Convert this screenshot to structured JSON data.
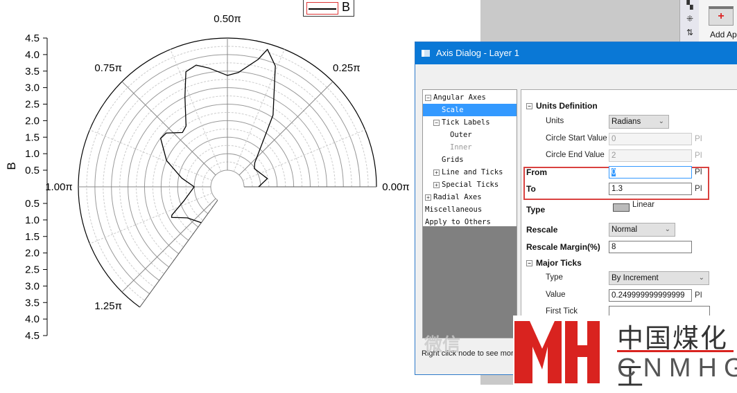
{
  "legend": {
    "label": "B"
  },
  "toolbar": {
    "add_app_label": "Add Ap"
  },
  "dialog": {
    "title": "Axis Dialog - Layer 1",
    "tree": [
      {
        "label": "Angular Axes",
        "toggle": "−",
        "level": 0
      },
      {
        "label": "Scale",
        "level": 1,
        "selected": true
      },
      {
        "label": "Tick Labels",
        "toggle": "−",
        "level": 1
      },
      {
        "label": "Outer",
        "level": 2
      },
      {
        "label": "Inner",
        "level": 2,
        "disabled": true
      },
      {
        "label": "Grids",
        "level": 1
      },
      {
        "label": "Line and Ticks",
        "toggle": "+",
        "level": 1
      },
      {
        "label": "Special Ticks",
        "toggle": "+",
        "level": 1
      },
      {
        "label": "Radial Axes",
        "toggle": "+",
        "level": 0
      },
      {
        "label": "Miscellaneous",
        "level": 0
      },
      {
        "label": "Apply to Others",
        "level": 0
      }
    ],
    "units_section": "Units Definition",
    "units_label": "Units",
    "units_value": "Radians",
    "circle_start_label": "Circle Start Value",
    "circle_start_value": "0",
    "circle_end_label": "Circle End Value",
    "circle_end_value": "2",
    "from_label": "From",
    "from_value": "0",
    "to_label": "To",
    "to_value": "1.3",
    "pi": "PI",
    "type_label": "Type",
    "type_value": "Linear",
    "rescale_label": "Rescale",
    "rescale_value": "Normal",
    "rescale_margin_label": "Rescale Margin(%)",
    "rescale_margin_value": "8",
    "major_ticks_section": "Major Ticks",
    "mt_type_label": "Type",
    "mt_type_value": "By Increment",
    "mt_value_label": "Value",
    "mt_value_value": "0.249999999999999",
    "first_tick_label": "First Tick",
    "first_tick_value": "",
    "status": "Right click node to see more"
  },
  "watermark": {
    "wechat": "微信",
    "logo_cn": "中国煤化工",
    "logo_en": "CNMHG",
    "logo_mark": "MH"
  },
  "chart_data": {
    "type": "line",
    "subtype": "polar",
    "theta_units": "pi",
    "theta_range": [
      0,
      1.3
    ],
    "r_range": [
      0.5,
      4.5
    ],
    "r_ticks": [
      "0.5",
      "1.0",
      "1.5",
      "2.0",
      "2.5",
      "3.0",
      "3.5",
      "4.0",
      "4.5"
    ],
    "angle_labels": [
      {
        "theta": 0,
        "label": "0.00π"
      },
      {
        "theta": 0.25,
        "label": "0.25π"
      },
      {
        "theta": 0.5,
        "label": "0.50π"
      },
      {
        "theta": 0.75,
        "label": "0.75π"
      },
      {
        "theta": 1,
        "label": "1.00π"
      },
      {
        "theta": 1.25,
        "label": "1.25π"
      }
    ],
    "ylabel": "B",
    "series": [
      {
        "name": "B",
        "theta": [
          0,
          0.065,
          0.19,
          0.23,
          0.32,
          0.38,
          0.41,
          0.425,
          0.47,
          0.5,
          0.55,
          0.58,
          0.61,
          0.64,
          0.69,
          0.72,
          0.77,
          0.8,
          0.87,
          0.94,
          1.0,
          1.1,
          1.15,
          1.16,
          1.21,
          1.3
        ],
        "r": [
          0.94,
          1.23,
          0.98,
          1.1,
          2.57,
          3.93,
          4.33,
          3.96,
          3.47,
          3.37,
          3.64,
          3.8,
          3.7,
          3.01,
          2.22,
          2.13,
          2.46,
          2.49,
          2.0,
          1.4,
          1.0,
          1.38,
          1.88,
          1.92,
          1.53,
          1.34
        ]
      }
    ],
    "grid": true
  }
}
